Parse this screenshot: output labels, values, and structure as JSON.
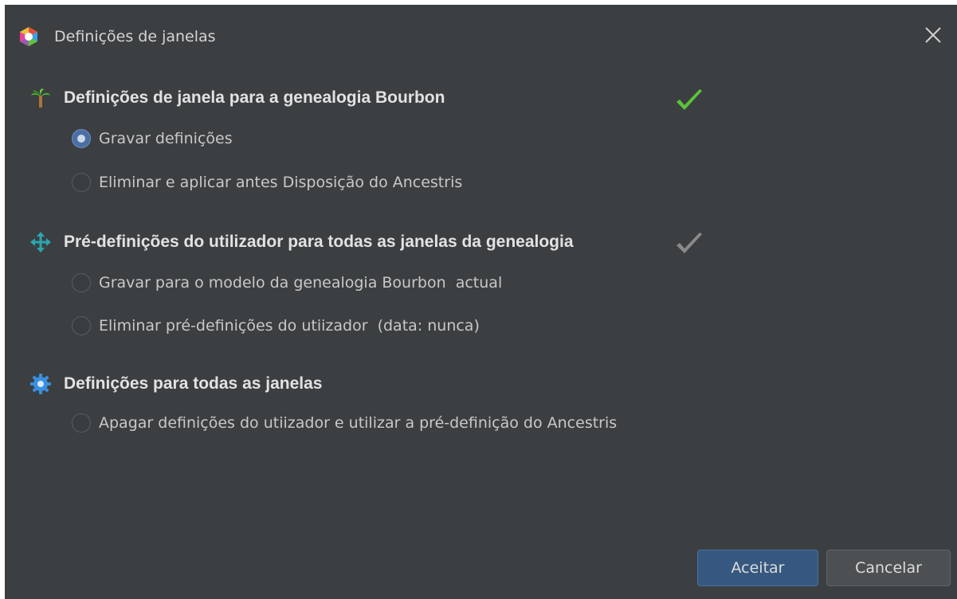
{
  "window": {
    "title": "Definições de janelas",
    "app_icon": "ancestris-hexagon-icon",
    "close_icon": "close-icon"
  },
  "sections": [
    {
      "title": "Definições de janela para a genealogia Bourbon",
      "icon": "palm-tree-icon",
      "checkmark": "green-checkmark-icon",
      "checkmark_color": "#5cc43a",
      "options": [
        {
          "label": "Gravar definições",
          "selected": true
        },
        {
          "label": "Eliminar e aplicar antes Disposição do Ancestris",
          "selected": false
        }
      ]
    },
    {
      "title": "Pré-definições do utilizador para todas as janelas da genealogia",
      "icon": "move-arrows-icon",
      "checkmark": "gray-checkmark-icon",
      "checkmark_color": "#8a8a8a",
      "options": [
        {
          "label": "Gravar para o modelo da genealogia Bourbon  actual",
          "selected": false
        },
        {
          "label": "Eliminar pré-definições do utiizador  (data: nunca)",
          "selected": false
        }
      ]
    },
    {
      "title": "Definições para todas as janelas",
      "icon": "gear-icon",
      "options": [
        {
          "label": "Apagar definições do utiizador e utilizar a pré-definição do Ancestris",
          "selected": false
        }
      ]
    }
  ],
  "buttons": {
    "accept_label": "Aceitar",
    "cancel_label": "Cancelar"
  },
  "colors": {
    "background": "#3c3f41",
    "primary_button": "#365880",
    "secondary_button": "#4c5052",
    "radio_selected": "#4a6fa5"
  }
}
